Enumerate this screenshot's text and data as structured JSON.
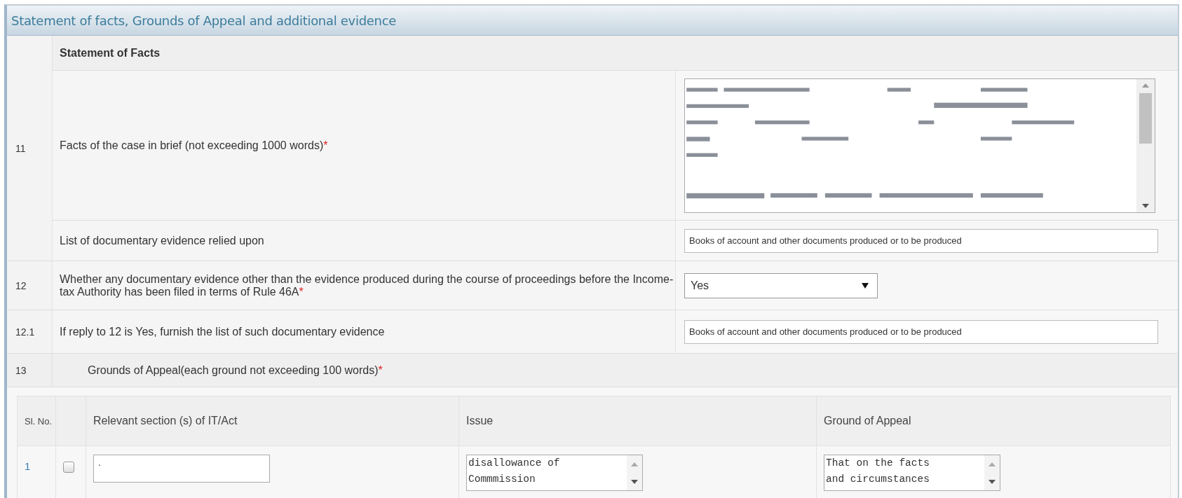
{
  "panel_title": "Statement of facts, Grounds of Appeal and additional evidence",
  "item_11": {
    "number": "11",
    "heading": "Statement of Facts",
    "fields": [
      {
        "kind": "textarea",
        "label": "Facts of the case in brief (not exceeding 1000 words)",
        "required_mark": "*"
      },
      {
        "kind": "text",
        "label": "List of documentary evidence relied upon",
        "value": "Books of account and other documents produced or to be produced"
      }
    ]
  },
  "rows": [
    {
      "number": "12",
      "kind": "select",
      "label": "Whether any documentary evidence other than the evidence produced during the course of proceedings before the Income-tax Authority has been filed in terms of Rule 46A",
      "required_mark": "*",
      "value": "Yes"
    },
    {
      "number": "12.1",
      "kind": "text",
      "label": "If reply to 12 is Yes, furnish the list of such documentary evidence",
      "value": "Books of account and other documents produced or to be produced"
    }
  ],
  "item_13": {
    "number": "13",
    "label": "Grounds of Appeal(each ground not exceeding 100 words)",
    "required_mark": "*"
  },
  "grounds_table": {
    "columns": {
      "sl_no": "Sl. No.",
      "section": "Relevant section (s) of IT/Act",
      "issue": "Issue",
      "ground": "Ground of Appeal"
    },
    "rows": [
      {
        "sl_no": "1",
        "checked": false,
        "section": ".",
        "issue": "disallowance of\nCommmission",
        "ground": "That on the facts\nand circumstances"
      }
    ]
  }
}
